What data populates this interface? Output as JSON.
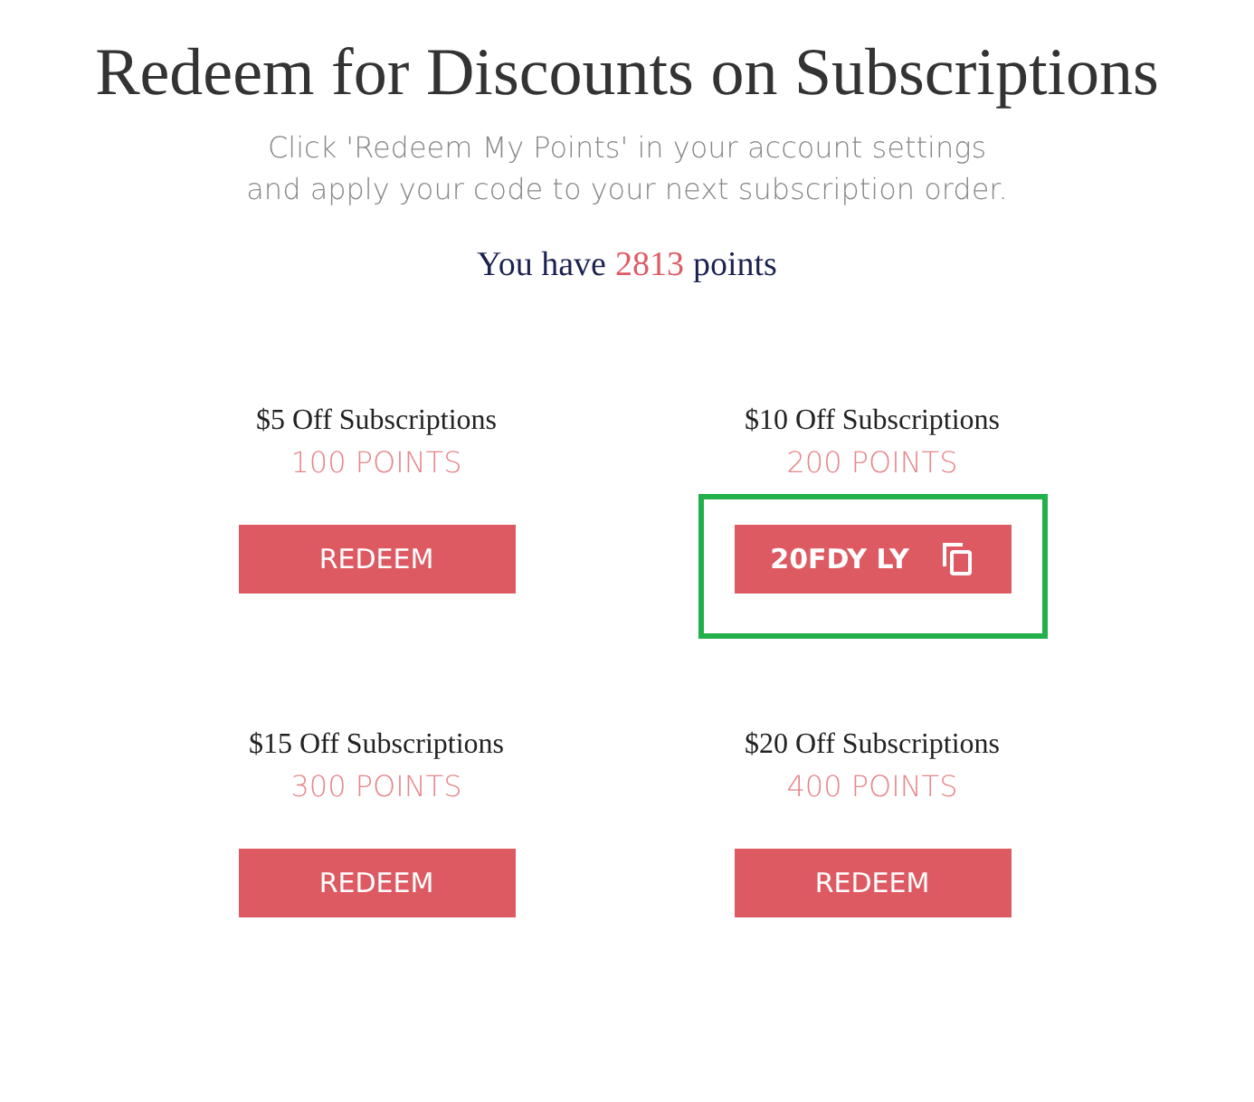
{
  "title": "Redeem for Discounts on Subscriptions",
  "instructions": "Click 'Redeem My Points' in your account settings and apply your code to your next subscription order.",
  "balance": {
    "prefix": "You have",
    "points": "2813",
    "suffix": "points"
  },
  "rewards": [
    {
      "name": "$5 Off Subscriptions",
      "cost": "100 POINTS",
      "kind": "redeem",
      "button": "REDEEM",
      "highlighted": false
    },
    {
      "name": "$10 Off Subscriptions",
      "cost": "200 POINTS",
      "kind": "code",
      "code": "20FDY LY",
      "highlighted": true
    },
    {
      "name": "$15 Off Subscriptions",
      "cost": "300 POINTS",
      "kind": "redeem",
      "button": "REDEEM",
      "highlighted": false
    },
    {
      "name": "$20 Off Subscriptions",
      "cost": "400 POINTS",
      "kind": "redeem",
      "button": "REDEEM",
      "highlighted": false
    }
  ]
}
